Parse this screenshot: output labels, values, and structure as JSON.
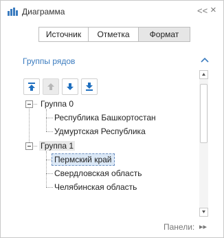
{
  "app": {
    "title": "Диаграмма",
    "icon": "bar-chart-icon",
    "collapse_glyph": "<<",
    "close_glyph": "×"
  },
  "tabs": [
    {
      "label": "Источник",
      "active": false
    },
    {
      "label": "Отметка",
      "active": false
    },
    {
      "label": "Формат",
      "active": true
    }
  ],
  "section": {
    "title": "Группы рядов",
    "chevron": "chevron-up-icon"
  },
  "toolbar": {
    "buttons": [
      {
        "name": "move-to-top-button",
        "icon": "arrow-up-to-line-icon",
        "enabled": true
      },
      {
        "name": "move-up-button",
        "icon": "arrow-up-icon",
        "enabled": false
      },
      {
        "name": "move-down-button",
        "icon": "arrow-down-icon",
        "enabled": true
      },
      {
        "name": "move-to-bottom-button",
        "icon": "arrow-down-to-line-icon",
        "enabled": true
      }
    ]
  },
  "tree": {
    "groups": [
      {
        "label": "Группа 0",
        "expanded": true,
        "items": [
          "Республика Башкортостан",
          "Удмуртская Республика"
        ]
      },
      {
        "label": "Группа 1",
        "expanded": true,
        "items": [
          "Пермский край",
          "Свердловская область",
          "Челябинская область"
        ]
      }
    ],
    "selected_group": "Группа 1",
    "focused_item": "Пермский край"
  },
  "footer": {
    "label": "Панели:",
    "next_glyph": "▸▸"
  },
  "colors": {
    "accent": "#3a7bbf",
    "border": "#c9c9c9",
    "active_tab": "#e6e6e6",
    "selection": "#dbe8f6"
  }
}
